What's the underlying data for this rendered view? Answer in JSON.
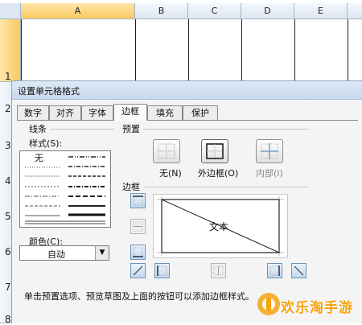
{
  "spreadsheet": {
    "columns": [
      "A",
      "B",
      "C",
      "D",
      "E"
    ],
    "rows": [
      "1",
      "2",
      "3",
      "4",
      "5",
      "6",
      "7",
      "8"
    ]
  },
  "dialog": {
    "title": "设置单元格格式",
    "tabs": [
      "数字",
      "对齐",
      "字体",
      "边框",
      "填充",
      "保护"
    ],
    "active_tab": "边框",
    "line_group": "线条",
    "style_label": "样式(S):",
    "style_none": "无",
    "color_label": "颜色(C):",
    "color_value": "自动",
    "preset_group": "预置",
    "presets": [
      "无(N)",
      "外边框(O)",
      "内部(I)"
    ],
    "border_group": "边框",
    "preview_text": "文本",
    "footer_hint": "单击预置选项、预览草图及上面的按钮可以添加边框样式。"
  },
  "watermark": {
    "text": "欢乐淘手游",
    "color": "#f6a30d"
  }
}
